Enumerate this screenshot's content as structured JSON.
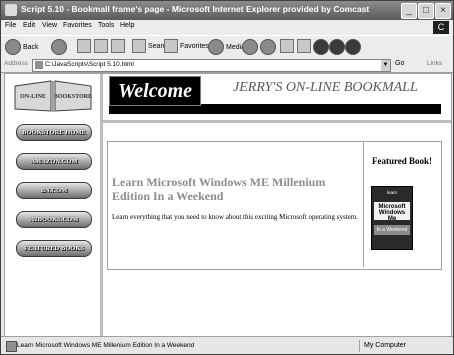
{
  "window": {
    "title": "Script 5.10 - Bookmall frame's page - Microsoft Internet Explorer provided by Comcast",
    "controls": [
      "_",
      "□",
      "×"
    ],
    "brand_glyph": "C"
  },
  "menu": [
    "File",
    "Edit",
    "View",
    "Favorites",
    "Tools",
    "Help"
  ],
  "toolbar": {
    "back": "Back",
    "search": "Search",
    "favorites": "Favorites",
    "media": "Media"
  },
  "address": {
    "label": "Address",
    "url": "C:\\JavaScripts\\Script 5.10.html",
    "go": "Go",
    "links": "Links"
  },
  "logo": {
    "left": "ON-LINE",
    "right": "BOOKSTORE"
  },
  "nav": [
    "BOOKSTORE HOME",
    "AMAZON.COM",
    "BN.COM",
    "A1BOOKS.COM",
    "FEATURED BOOKS"
  ],
  "top": {
    "welcome": "Welcome",
    "site_title": "JERRY'S ON-LINE BOOKMALL"
  },
  "main": {
    "book_title": "Learn Microsoft Windows ME Millenium Edition In a Weekend",
    "book_desc": "Learn everything that you need to know about this exciting Microsoft operating system.",
    "featured_heading": "Featured Book!",
    "cover": {
      "line1": "learn",
      "line2": "Microsoft",
      "line3": "Windows Me",
      "line4": "In a Weekend"
    }
  },
  "status": {
    "text": "Learn Microsoft Windows ME Millenium Edition In a Weekend",
    "zone": "My Computer"
  },
  "colors": {
    "titlebar": "#6f6f6f",
    "frame_border": "#bcbcbc",
    "book_title": "#8c8c8c",
    "nav_button": "#9a9a9a"
  }
}
